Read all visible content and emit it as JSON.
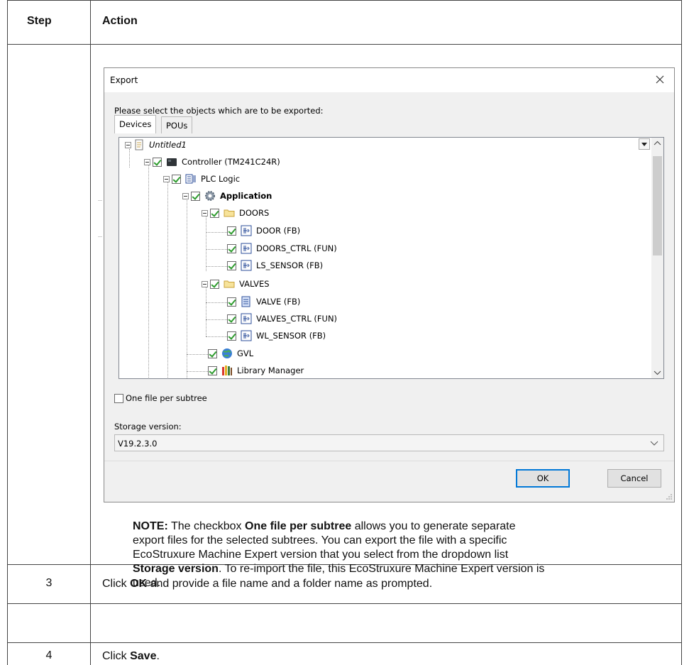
{
  "table": {
    "headers": {
      "step": "Step",
      "action": "Action"
    },
    "note": {
      "label": "NOTE:",
      "text_1": " The checkbox ",
      "bold_1": "One file per subtree",
      "text_2": " allows you to generate separate",
      "line_2": "export files for the selected subtrees. You can export the file with a specific",
      "line_3": "EcoStruxure Machine Expert version that you select from the dropdown list",
      "bold_2": "Storage version",
      "text_3": ". To re-import the file, this EcoStruxure Machine Expert version is",
      "line_5": "used."
    },
    "rows": [
      {
        "step": "3",
        "pre": "Click ",
        "bold": "OK",
        "post": " and provide a file name and a folder name as prompted."
      },
      {
        "step": "4",
        "pre": "Click ",
        "bold": "Save",
        "post": "."
      }
    ]
  },
  "dialog": {
    "title": "Export",
    "prompt": "Please select the objects which are to be exported:",
    "tabs": [
      "Devices",
      "POUs"
    ],
    "tree": [
      {
        "label": "Untitled1",
        "level": 0,
        "icon": "project-icon",
        "checkbox": false,
        "italic": true
      },
      {
        "label": "Controller (TM241C24R)",
        "level": 1,
        "icon": "controller-icon",
        "checkbox": true
      },
      {
        "label": "PLC Logic",
        "level": 2,
        "icon": "plc-logic-icon",
        "checkbox": true
      },
      {
        "label": "Application",
        "level": 3,
        "icon": "gear-icon",
        "checkbox": true,
        "bold": true
      },
      {
        "label": "DOORS",
        "level": 4,
        "icon": "folder-icon",
        "checkbox": true
      },
      {
        "label": "DOOR (FB)",
        "level": 5,
        "icon": "function-block-icon",
        "checkbox": true
      },
      {
        "label": "DOORS_CTRL (FUN)",
        "level": 5,
        "icon": "function-block-icon",
        "checkbox": true
      },
      {
        "label": "LS_SENSOR (FB)",
        "level": 5,
        "icon": "function-block-icon",
        "checkbox": true
      },
      {
        "label": "VALVES",
        "level": 4,
        "icon": "folder-icon",
        "checkbox": true
      },
      {
        "label": "VALVE (FB)",
        "level": 5,
        "icon": "document-icon",
        "checkbox": true
      },
      {
        "label": "VALVES_CTRL (FUN)",
        "level": 5,
        "icon": "function-block-icon",
        "checkbox": true
      },
      {
        "label": "WL_SENSOR (FB)",
        "level": 5,
        "icon": "function-block-icon",
        "checkbox": true
      },
      {
        "label": "GVL",
        "level": 4,
        "icon": "globe-icon",
        "checkbox": true
      },
      {
        "label": "Library Manager",
        "level": 4,
        "icon": "library-icon",
        "checkbox": true
      }
    ],
    "one_file_label": "One file per subtree",
    "one_file_checked": false,
    "storage_label": "Storage version:",
    "storage_value": "V19.2.3.0",
    "ok_label": "OK",
    "cancel_label": "Cancel"
  },
  "colors": {
    "accent": "#0078d7",
    "check": "#2e9c2e",
    "border": "#444444"
  }
}
